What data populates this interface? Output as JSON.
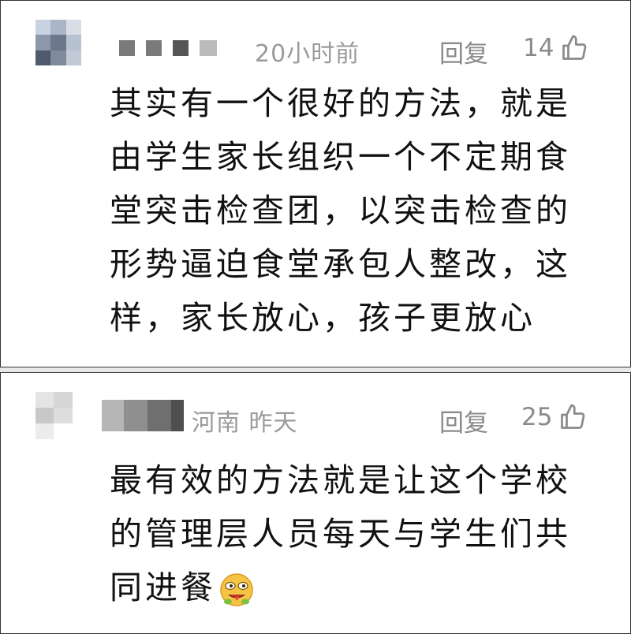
{
  "comments": [
    {
      "time": "20小时前",
      "reply_label": "回复",
      "likes": "14",
      "text": "其实有一个很好的方法，就是由学生家长组织一个不定期食堂突击检查团，以突击检查的形势逼迫食堂承包人整改，这样，家长放心，孩子更放心"
    },
    {
      "location_time": "河南 昨天",
      "reply_label": "回复",
      "likes": "25",
      "text": "最有效的方法就是让这个学校的管理层人员每天与学生们共同进餐"
    }
  ],
  "icons": {
    "like": "thumbs-up-icon",
    "emoji": "salivating-face-emoji"
  },
  "colors": {
    "meta_text": "#9a9a9a",
    "body_text": "#111111",
    "border": "#333333"
  }
}
